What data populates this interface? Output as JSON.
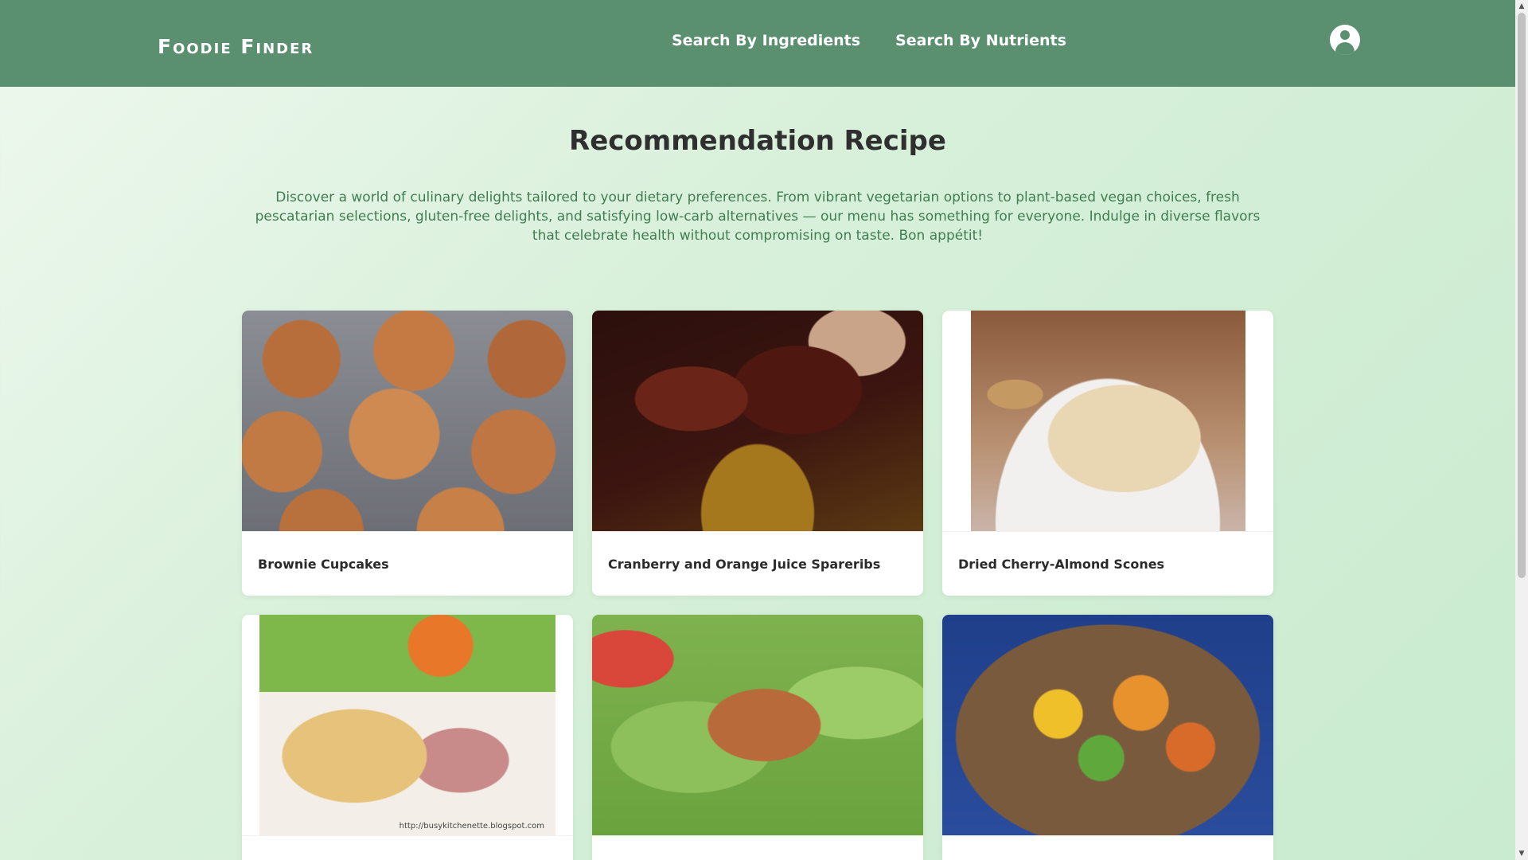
{
  "header": {
    "logo": "Foodie Finder",
    "nav": [
      {
        "label": "Search By Ingredients"
      },
      {
        "label": "Search By Nutrients"
      }
    ],
    "user_icon": "user-circle-icon"
  },
  "main": {
    "title": "Recommendation Recipe",
    "intro": "Discover a world of culinary delights tailored to your dietary preferences. From vibrant vegetarian options to plant-based vegan choices, fresh pescatarian selections, gluten-free delights, and satisfying low-carb alternatives — our menu has something for everyone. Indulge in diverse flavors that celebrate health without compromising on taste. Bon appétit!",
    "recipes": [
      {
        "title": "Brownie Cupcakes",
        "image": "brownie-cupcakes-photo"
      },
      {
        "title": "Cranberry and Orange Juice Spareribs",
        "image": "spareribs-photo"
      },
      {
        "title": "Dried Cherry-Almond Scones",
        "image": "scones-photo"
      },
      {
        "title": "",
        "image": "stuffed-chicken-photo",
        "image_caption": "http://busykitchenette.blogspot.com"
      },
      {
        "title": "",
        "image": "lettuce-wraps-photo"
      },
      {
        "title": "",
        "image": "paella-photo"
      }
    ]
  }
}
